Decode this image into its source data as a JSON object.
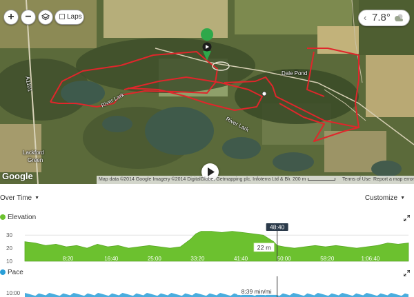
{
  "map": {
    "controls": {
      "zoom_in_label": "+",
      "zoom_out_label": "−",
      "layers_icon": "layers-icon",
      "laps_label": "Laps",
      "laps_checked": false
    },
    "weather": {
      "temperature": "7.8°",
      "chevron": "‹",
      "icon": "cloudy-icon"
    },
    "place_labels": [
      "A1101",
      "River Lark",
      "River Lark",
      "Dale Pond",
      "Lackford",
      "Green"
    ],
    "google_logo": "Google",
    "attribution": "Map data ©2014 Google Imagery ©2014 DigitalGlobe, Getmapping plc, Infoterra Ltd & Bluesky",
    "scale_label": "200 m",
    "terms_label": "Terms of Use",
    "report_label": "Report a map error",
    "colors": {
      "track": "#e0262b",
      "start_marker": "#2ea84a",
      "satellite": "#5f6b3e"
    }
  },
  "toolbar": {
    "view_label": "Over Time",
    "customize_label": "Customize"
  },
  "elevation": {
    "title": "Elevation",
    "color": "#6cc12f",
    "y_ticks": [
      "30",
      "20",
      "10"
    ],
    "x_ticks": [
      "8:20",
      "16:40",
      "25:00",
      "33:20",
      "41:40",
      "50:00",
      "58:20",
      "1:06:40"
    ],
    "cursor_time": "48:40",
    "cursor_value": "22 m"
  },
  "pace": {
    "title": "Pace",
    "color": "#2a9fd8",
    "y_ticks": [
      "10:00"
    ],
    "cursor_value": "8:39 min/mi"
  },
  "chart_data": [
    {
      "type": "area",
      "title": "Elevation",
      "xlabel": "",
      "ylabel": "",
      "unit": "m",
      "x_unit": "minutes",
      "ylim": [
        10,
        37
      ],
      "xlim": [
        0,
        74
      ],
      "x_ticks": [
        "8:20",
        "16:40",
        "25:00",
        "33:20",
        "41:40",
        "50:00",
        "58:20",
        "1:06:40"
      ],
      "y_ticks": [
        10,
        20,
        30
      ],
      "grid": true,
      "x": [
        0,
        2,
        4,
        6,
        8,
        10,
        12,
        14,
        16,
        18,
        20,
        22,
        24,
        26,
        28,
        30,
        32,
        33,
        34,
        36,
        38,
        40,
        42,
        44,
        46,
        48,
        48.67,
        50,
        52,
        54,
        56,
        58,
        60,
        62,
        64,
        66,
        68,
        70,
        72,
        74
      ],
      "series": [
        {
          "values": [
            25,
            24,
            22,
            23,
            21,
            22,
            20,
            23,
            21,
            22,
            20,
            21,
            22,
            21,
            20,
            21,
            27,
            31,
            33,
            33,
            32,
            33,
            32,
            31,
            30,
            25,
            22,
            21,
            20,
            21,
            22,
            21,
            22,
            21,
            20,
            21,
            22,
            24,
            23,
            24
          ]
        }
      ],
      "cursor": {
        "x_label": "48:40",
        "value_label": "22 m"
      }
    },
    {
      "type": "area",
      "title": "Pace",
      "unit": "min/mi",
      "y_ticks": [
        "10:00"
      ],
      "cursor": {
        "value_label": "8:39 min/mi"
      }
    }
  ]
}
